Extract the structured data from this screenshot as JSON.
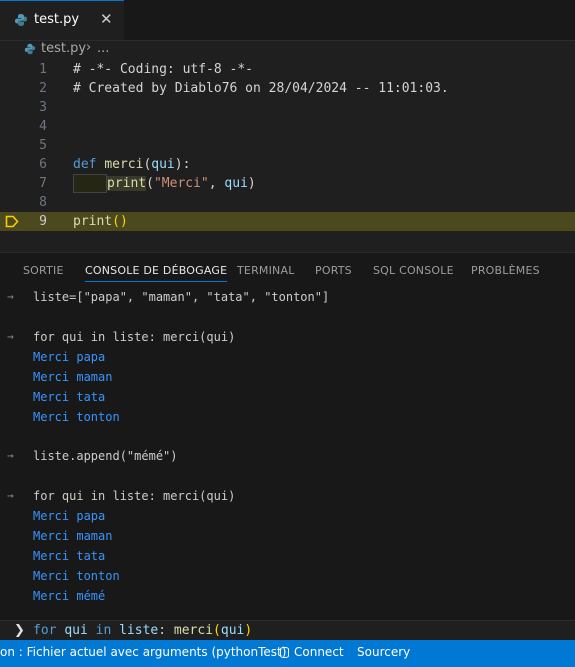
{
  "tab": {
    "filename": "test.py",
    "close_glyph": "✕"
  },
  "breadcrumb": {
    "file": "test.py",
    "separator": "›",
    "more": "..."
  },
  "editor": {
    "lines": [
      {
        "n": "1",
        "comment": "# -*- Coding: utf-8 -*-"
      },
      {
        "n": "2",
        "comment": "# Created by Diablo76 on 28/04/2024 -- 11:01:03."
      },
      {
        "n": "3"
      },
      {
        "n": "4"
      },
      {
        "n": "5"
      },
      {
        "n": "6",
        "kw": "def",
        "fn": "merci",
        "p1": "(",
        "param": "qui",
        "p2": "):"
      },
      {
        "n": "7",
        "fn": "print",
        "p1": "(",
        "str": "\"Merci\"",
        "comma": ", ",
        "param": "qui",
        "p2": ")"
      },
      {
        "n": "8"
      },
      {
        "n": "9",
        "fn": "print",
        "parens": "()"
      }
    ],
    "current_line": "9"
  },
  "panel": {
    "tabs": [
      {
        "label": "SORTIE",
        "active": false
      },
      {
        "label": "CONSOLE DE DÉBOGAGE",
        "active": true
      },
      {
        "label": "TERMINAL",
        "active": false
      },
      {
        "label": "PORTS",
        "active": false
      },
      {
        "label": "SQL CONSOLE",
        "active": false
      },
      {
        "label": "PROBLÈMES",
        "active": false
      }
    ],
    "console": [
      {
        "type": "input",
        "text": "liste=[\"papa\", \"maman\", \"tata\", \"tonton\"]"
      },
      {
        "type": "blank",
        "text": ""
      },
      {
        "type": "input",
        "text": "for qui in liste: merci(qui)"
      },
      {
        "type": "output",
        "text": "Merci papa"
      },
      {
        "type": "output",
        "text": "Merci maman"
      },
      {
        "type": "output",
        "text": "Merci tata"
      },
      {
        "type": "output",
        "text": "Merci tonton"
      },
      {
        "type": "blank",
        "text": ""
      },
      {
        "type": "input",
        "text": "liste.append(\"mémé\")"
      },
      {
        "type": "blank",
        "text": ""
      },
      {
        "type": "input",
        "text": "for qui in liste: merci(qui)"
      },
      {
        "type": "output",
        "text": "Merci papa"
      },
      {
        "type": "output",
        "text": "Merci maman"
      },
      {
        "type": "output",
        "text": "Merci tata"
      },
      {
        "type": "output",
        "text": "Merci tonton"
      },
      {
        "type": "output",
        "text": "Merci mémé"
      }
    ],
    "prompt": {
      "chevron": "❯",
      "kw1": "for",
      "v1": "qui",
      "kw2": "in",
      "v2": "liste",
      "colon": ":",
      "fn": "merci",
      "open": "(",
      "arg": "qui",
      "close": ")"
    }
  },
  "statusbar": {
    "debug_config": "on : Fichier actuel avec arguments (pythonTest)",
    "connect": "Connect",
    "sourcery": "Sourcery"
  },
  "colors": {
    "accent": "#0078d4",
    "comment": "#6a9955",
    "keyword": "#569cd6",
    "function": "#dcdcaa",
    "string": "#ce9178",
    "variable": "#9cdcfe",
    "output": "#3794ff",
    "current_line": "#4b4a1f",
    "breakpoint": "#ffcc00"
  }
}
